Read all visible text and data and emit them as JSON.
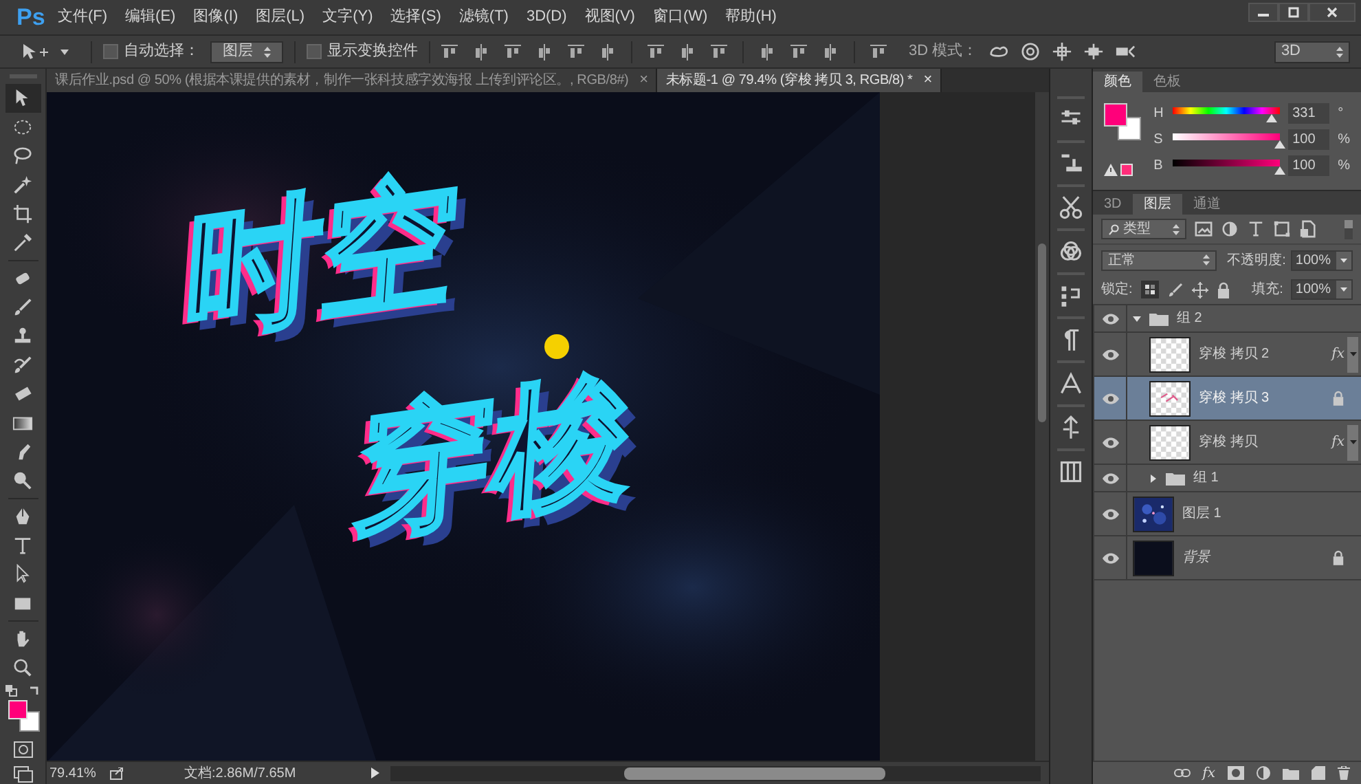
{
  "menu_bar": {
    "logo": "Ps",
    "items": [
      "文件(F)",
      "编辑(E)",
      "图像(I)",
      "图层(L)",
      "文字(Y)",
      "选择(S)",
      "滤镜(T)",
      "3D(D)",
      "视图(V)",
      "窗口(W)",
      "帮助(H)"
    ]
  },
  "options_bar": {
    "auto_select": {
      "label": "自动选择：",
      "checked": false
    },
    "auto_select_target": "图层",
    "show_transform": {
      "label": "显示变换控件",
      "checked": false
    },
    "mode_label": "3D 模式：",
    "workspace": "3D"
  },
  "document_tabs": [
    {
      "title": "课后作业.psd @ 50% (根据本课提供的素材，制作一张科技感字效海报 上传到评论区。, RGB/8#)",
      "close": "×",
      "selected": false
    },
    {
      "title": "未标题-1 @ 79.4% (穿梭 拷贝 3, RGB/8) *",
      "close": "×",
      "selected": true
    }
  ],
  "canvas": {
    "artwork_lines": [
      "时空",
      "穿梭"
    ]
  },
  "status_bar": {
    "zoom": "79.41%",
    "doc_size": "文档:2.86M/7.65M"
  },
  "color_panel": {
    "tabs": [
      {
        "label": "颜色",
        "selected": true
      },
      {
        "label": "色板",
        "selected": false
      }
    ],
    "channels": [
      {
        "label": "H",
        "level": 0.92,
        "value": "331",
        "unit": "°"
      },
      {
        "label": "S",
        "level": 1,
        "value": "100",
        "unit": "%"
      },
      {
        "label": "B",
        "level": 1,
        "value": "100",
        "unit": "%"
      }
    ]
  },
  "layers_panel": {
    "tabs": [
      {
        "label": "3D",
        "selected": false
      },
      {
        "label": "图层",
        "selected": true
      },
      {
        "label": "通道",
        "selected": false
      }
    ],
    "filter": "类型",
    "blend_mode": "正常",
    "opacity_label": "不透明度:",
    "opacity": "100%",
    "lock_label": "锁定:",
    "fill_label": "填充:",
    "fill": "100%",
    "layers": [
      {
        "name": "组 2",
        "kind": "group",
        "visible": true,
        "expanded": true,
        "selected": false,
        "children": [
          {
            "name": "穿梭 拷贝 2",
            "kind": "transparent_layer",
            "visible": true,
            "selected": false,
            "locked": false,
            "effects": "fx"
          },
          {
            "name": "穿梭 拷贝 3",
            "kind": "marked_layer",
            "visible": true,
            "selected": true,
            "locked": true
          },
          {
            "name": "穿梭 拷贝",
            "kind": "transparent_layer",
            "visible": true,
            "selected": false,
            "locked": false,
            "effects": "fx"
          },
          {
            "name": "组 1",
            "kind": "group",
            "visible": true,
            "expanded": false,
            "selected": false
          }
        ]
      },
      {
        "name": "图层 1",
        "kind": "picture_layer",
        "visible": true,
        "selected": false,
        "locked": false
      },
      {
        "name": "背景",
        "kind": "background",
        "visible": true,
        "selected": false,
        "locked": true
      }
    ],
    "fx_button": "fx"
  }
}
